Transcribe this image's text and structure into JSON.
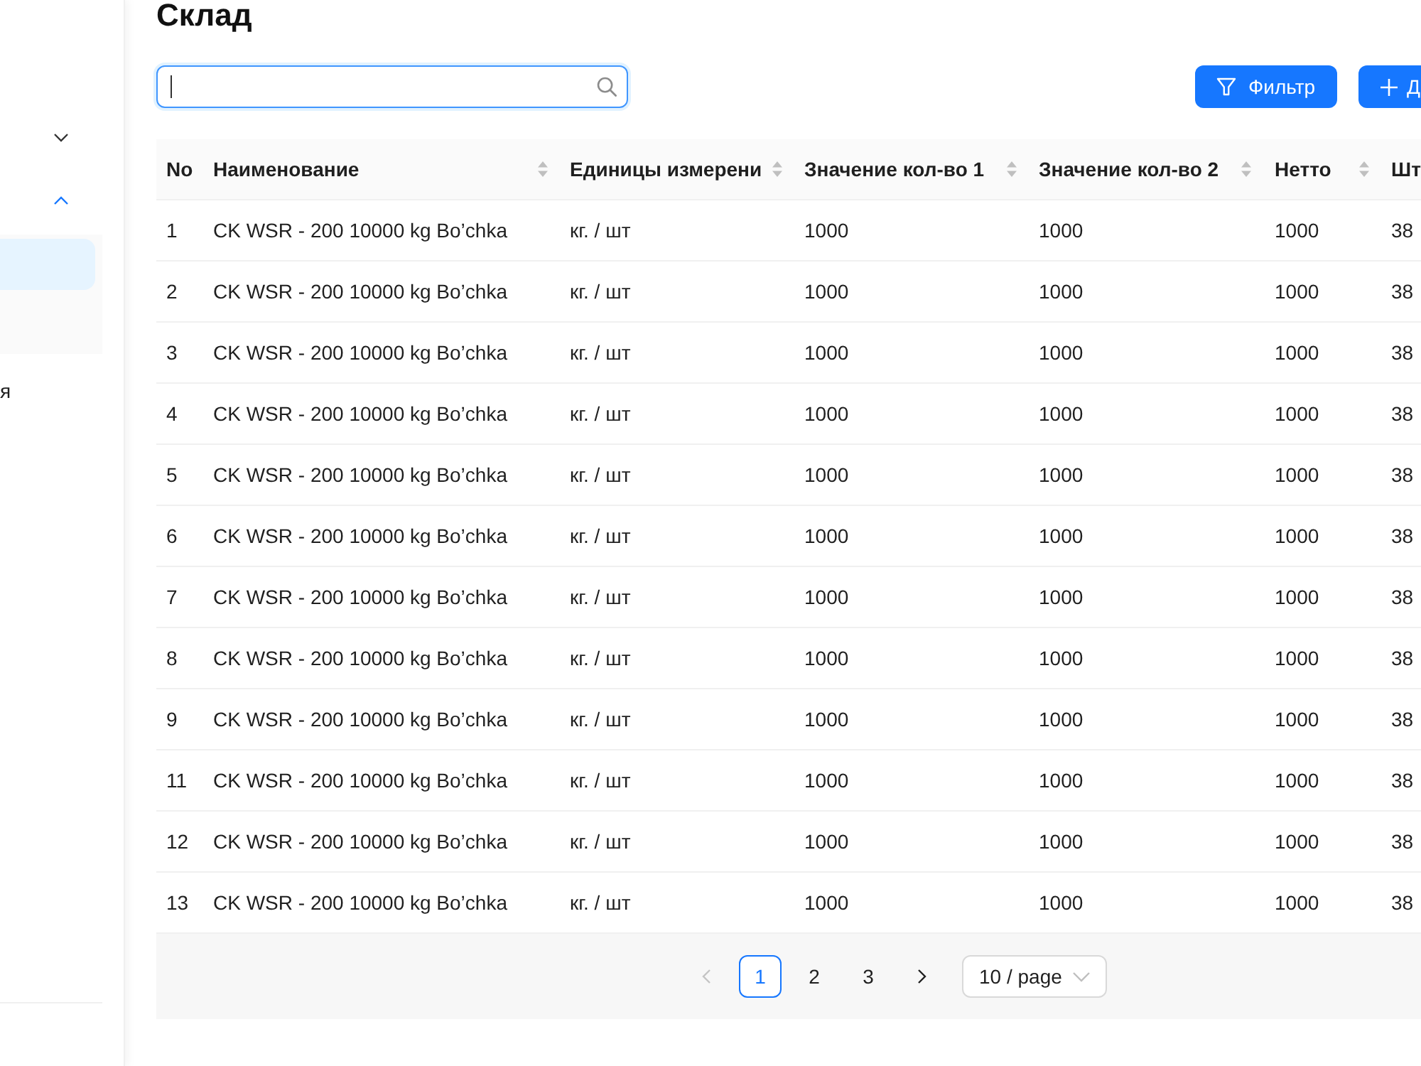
{
  "title": "Склад",
  "sidebar": {
    "items": [
      {
        "kind": "submenu",
        "expanded": false
      },
      {
        "kind": "submenu",
        "expanded": true,
        "children": [
          {
            "selected": true
          }
        ]
      },
      {
        "kind": "item",
        "label": "я"
      }
    ]
  },
  "toolbar": {
    "search": {
      "focused": true
    },
    "buttons": [
      {
        "kind": "filter",
        "label": "Фильтр"
      },
      {
        "kind": "add",
        "label": "Д"
      }
    ]
  },
  "table": {
    "columns": [
      {
        "label": "No",
        "sortable": false
      },
      {
        "label": "Наименование",
        "sortable": true
      },
      {
        "label": "Единицы измерени",
        "sortable": true
      },
      {
        "label": "Значение кол-во 1",
        "sortable": true
      },
      {
        "label": "Значение кол-во 2",
        "sortable": true
      },
      {
        "label": "Нетто",
        "sortable": true
      },
      {
        "label": "Шт",
        "sortable": false
      }
    ],
    "rows": [
      [
        "1",
        "CK WSR - 200 10000 kg Bo’chka",
        "кг. / шт",
        "1000",
        "1000",
        "1000",
        "38"
      ],
      [
        "2",
        "CK WSR - 200 10000 kg Bo’chka",
        "кг. / шт",
        "1000",
        "1000",
        "1000",
        "38"
      ],
      [
        "3",
        "CK WSR - 200 10000 kg Bo’chka",
        "кг. / шт",
        "1000",
        "1000",
        "1000",
        "38"
      ],
      [
        "4",
        "CK WSR - 200 10000 kg Bo’chka",
        "кг. / шт",
        "1000",
        "1000",
        "1000",
        "38"
      ],
      [
        "5",
        "CK WSR - 200 10000 kg Bo’chka",
        "кг. / шт",
        "1000",
        "1000",
        "1000",
        "38"
      ],
      [
        "6",
        "CK WSR - 200 10000 kg Bo’chka",
        "кг. / шт",
        "1000",
        "1000",
        "1000",
        "38"
      ],
      [
        "7",
        "CK WSR - 200 10000 kg Bo’chka",
        "кг. / шт",
        "1000",
        "1000",
        "1000",
        "38"
      ],
      [
        "8",
        "CK WSR - 200 10000 kg Bo’chka",
        "кг. / шт",
        "1000",
        "1000",
        "1000",
        "38"
      ],
      [
        "9",
        "CK WSR - 200 10000 kg Bo’chka",
        "кг. / шт",
        "1000",
        "1000",
        "1000",
        "38"
      ],
      [
        "11",
        "CK WSR - 200 10000 kg Bo’chka",
        "кг. / шт",
        "1000",
        "1000",
        "1000",
        "38"
      ],
      [
        "12",
        "CK WSR - 200 10000 kg Bo’chka",
        "кг. / шт",
        "1000",
        "1000",
        "1000",
        "38"
      ],
      [
        "13",
        "CK WSR - 200 10000 kg Bo’chka",
        "кг. / шт",
        "1000",
        "1000",
        "1000",
        "38"
      ]
    ]
  },
  "pagination": {
    "prev_disabled": true,
    "next_disabled": false,
    "pages": [
      {
        "label": "1",
        "selected": true
      },
      {
        "label": "2",
        "selected": false
      },
      {
        "label": "3",
        "selected": false
      }
    ],
    "page_size": "10 / page"
  }
}
